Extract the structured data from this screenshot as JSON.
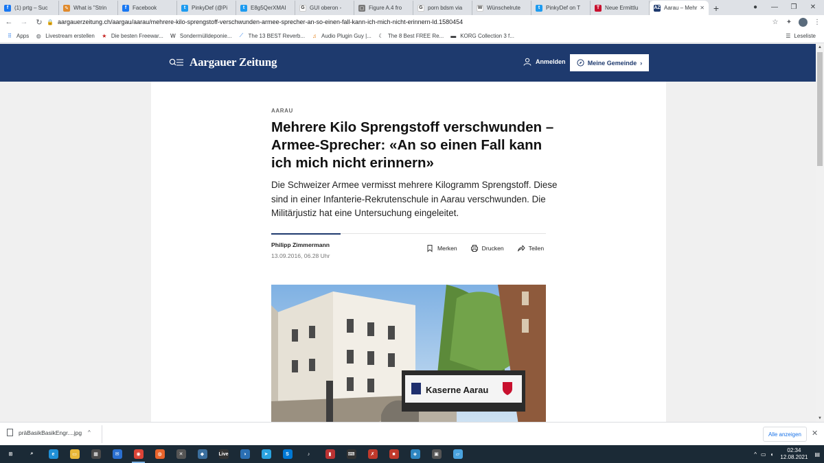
{
  "browser": {
    "tabs": [
      {
        "title": "(1) prtg – Suc",
        "favicon": "facebook-icon",
        "color": "#1877f2",
        "glyph": "f"
      },
      {
        "title": "What is \"Strin",
        "favicon": "pen-icon",
        "color": "#e08a2c",
        "glyph": "✎"
      },
      {
        "title": "Facebook",
        "favicon": "facebook-icon",
        "color": "#1877f2",
        "glyph": "f"
      },
      {
        "title": "PinkyDef (@Pi",
        "favicon": "twitter-icon",
        "color": "#1d9bf0",
        "glyph": "t"
      },
      {
        "title": "E8g5QerXMAI",
        "favicon": "twitter-icon",
        "color": "#1d9bf0",
        "glyph": "t"
      },
      {
        "title": "GUI oberon -",
        "favicon": "google-icon",
        "color": "#ffffff",
        "glyph": "G"
      },
      {
        "title": "Figure A.4 fro",
        "favicon": "document-icon",
        "color": "#777777",
        "glyph": "▢"
      },
      {
        "title": "porn bdsm via",
        "favicon": "google-icon",
        "color": "#ffffff",
        "glyph": "G"
      },
      {
        "title": "Wünschelrute",
        "favicon": "wikipedia-icon",
        "color": "#ffffff",
        "glyph": "W"
      },
      {
        "title": "PinkyDef on T",
        "favicon": "twitter-icon",
        "color": "#1d9bf0",
        "glyph": "t"
      },
      {
        "title": "Neue Ermittlu",
        "favicon": "news-icon",
        "color": "#c8102e",
        "glyph": "T"
      },
      {
        "title": "Aarau – Mehr",
        "favicon": "az-icon",
        "color": "#1e3a6e",
        "glyph": "AZ",
        "active": true
      }
    ],
    "url": "aargauerzeitung.ch/aargau/aarau/mehrere-kilo-sprengstoff-verschwunden-armee-sprecher-an-so-einen-fall-kann-ich-mich-nicht-erinnern-ld.1580454",
    "bookmarks": [
      {
        "label": "Apps",
        "icon": "apps-grid-icon"
      },
      {
        "label": "Livestream erstellen",
        "icon": "globe-icon"
      },
      {
        "label": "Die besten Freewar...",
        "icon": "star-icon"
      },
      {
        "label": "Sondermülldeponie...",
        "icon": "w-icon"
      },
      {
        "label": "The 13 BEST Reverb...",
        "icon": "plugin-icon"
      },
      {
        "label": "Audio Plugin Guy |...",
        "icon": "headphones-icon"
      },
      {
        "label": "The 8 Best FREE Re...",
        "icon": "moon-icon"
      },
      {
        "label": "KORG Collection 3 f...",
        "icon": "korg-icon"
      }
    ],
    "reading_list": "Leseliste"
  },
  "site": {
    "logo": "Aargauer Zeitung",
    "login": "Anmelden",
    "gemeinde": "Meine Gemeinde",
    "accent": "#1e3a6e"
  },
  "article": {
    "kicker": "AARAU",
    "headline": "Mehrere Kilo Sprengstoff verschwunden – Armee-Sprecher: «An so einen Fall kann ich mich nicht erinnern»",
    "lead": "Die Schweizer Armee vermisst mehrere Kilogramm Sprengstoff. Diese sind in einer Infanterie-Rekrutenschule in Aarau verschwunden. Die Militärjustiz hat eine Untersuchung eingeleitet.",
    "author": "Philipp Zimmermann",
    "date": "13.09.2016, 06.28 Uhr",
    "actions": {
      "bookmark": "Merken",
      "print": "Drucken",
      "share": "Teilen"
    },
    "photo_sign": "Kaserne  Aarau"
  },
  "downloads": {
    "file": "präBasikBasikEngr....jpg",
    "show_all": "Alle anzeigen"
  },
  "taskbar": {
    "time": "02:34",
    "date": "12.08.2021"
  }
}
